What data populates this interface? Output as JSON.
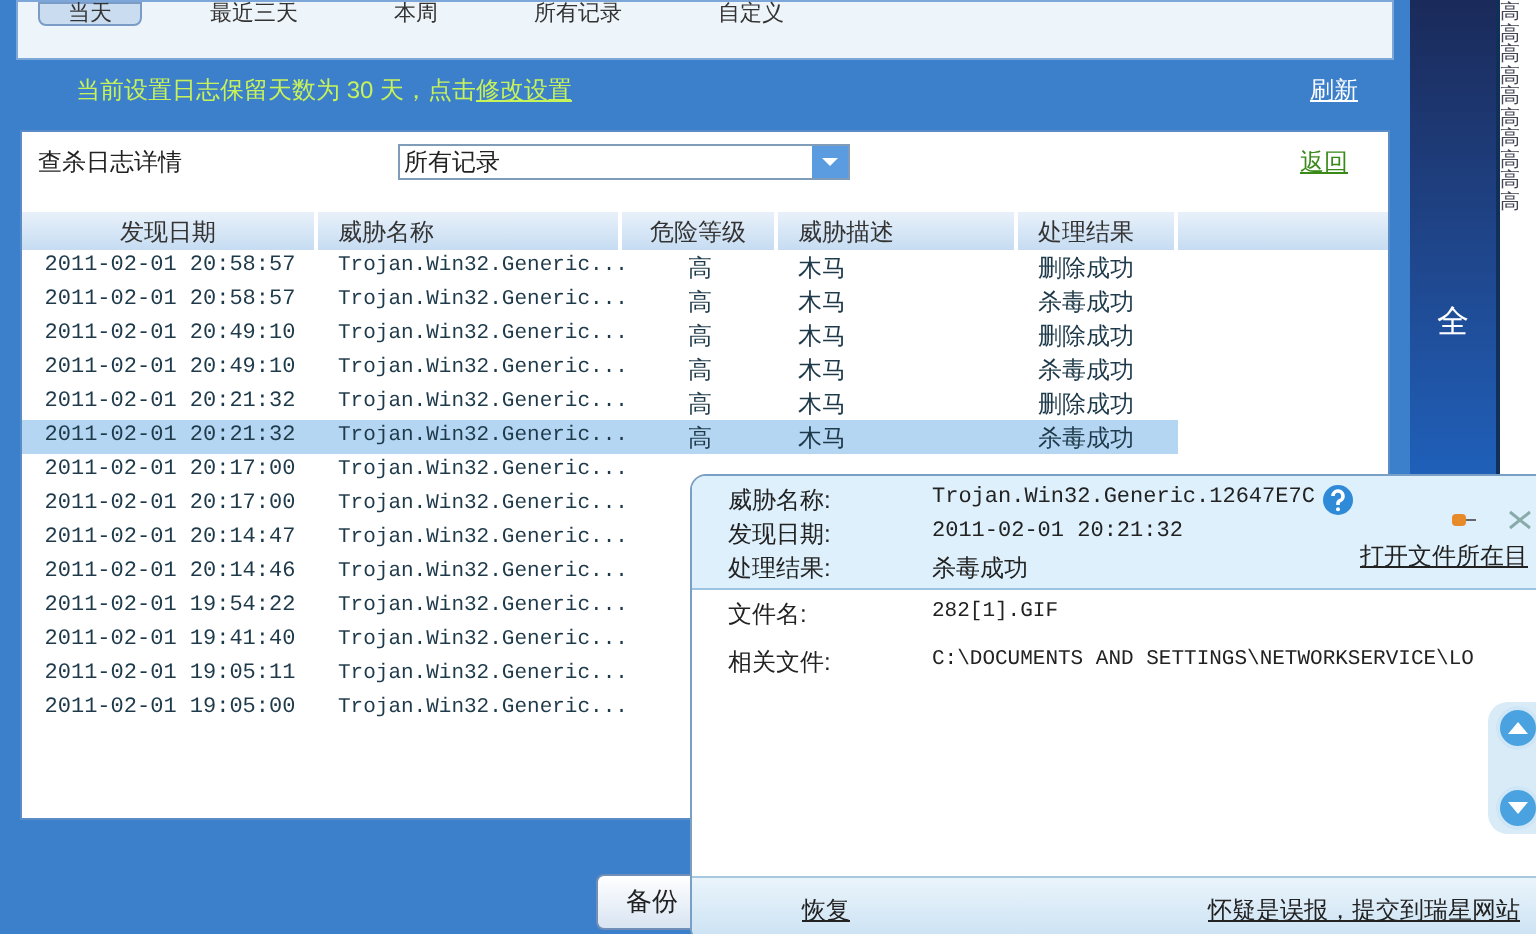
{
  "tabs": [
    {
      "label": "当天",
      "selected": true
    },
    {
      "label": "最近三天",
      "selected": false
    },
    {
      "label": "本周",
      "selected": false
    },
    {
      "label": "所有记录",
      "selected": false
    },
    {
      "label": "自定义",
      "selected": false
    }
  ],
  "notice": {
    "text": "当前设置日志保留天数为 30 天，点击",
    "link": "修改设置"
  },
  "refresh": "刷新",
  "filter": {
    "label": "查杀日志详情",
    "value": "所有记录"
  },
  "back": "返回",
  "table": {
    "columns": [
      "发现日期",
      "威胁名称",
      "危险等级",
      "威胁描述",
      "处理结果"
    ],
    "rows": [
      {
        "date": "2011-02-01 20:58:57",
        "name": "Trojan.Win32.Generic...",
        "level": "高",
        "desc": "木马",
        "result": "删除成功",
        "selected": false
      },
      {
        "date": "2011-02-01 20:58:57",
        "name": "Trojan.Win32.Generic...",
        "level": "高",
        "desc": "木马",
        "result": "杀毒成功",
        "selected": false
      },
      {
        "date": "2011-02-01 20:49:10",
        "name": "Trojan.Win32.Generic...",
        "level": "高",
        "desc": "木马",
        "result": "删除成功",
        "selected": false
      },
      {
        "date": "2011-02-01 20:49:10",
        "name": "Trojan.Win32.Generic...",
        "level": "高",
        "desc": "木马",
        "result": "杀毒成功",
        "selected": false
      },
      {
        "date": "2011-02-01 20:21:32",
        "name": "Trojan.Win32.Generic...",
        "level": "高",
        "desc": "木马",
        "result": "删除成功",
        "selected": false
      },
      {
        "date": "2011-02-01 20:21:32",
        "name": "Trojan.Win32.Generic...",
        "level": "高",
        "desc": "木马",
        "result": "杀毒成功",
        "selected": true
      },
      {
        "date": "2011-02-01 20:17:00",
        "name": "Trojan.Win32.Generic...",
        "selected": false
      },
      {
        "date": "2011-02-01 20:17:00",
        "name": "Trojan.Win32.Generic...",
        "selected": false
      },
      {
        "date": "2011-02-01 20:14:47",
        "name": "Trojan.Win32.Generic...",
        "selected": false
      },
      {
        "date": "2011-02-01 20:14:46",
        "name": "Trojan.Win32.Generic...",
        "selected": false
      },
      {
        "date": "2011-02-01 19:54:22",
        "name": "Trojan.Win32.Generic...",
        "selected": false
      },
      {
        "date": "2011-02-01 19:41:40",
        "name": "Trojan.Win32.Generic...",
        "selected": false
      },
      {
        "date": "2011-02-01 19:05:11",
        "name": "Trojan.Win32.Generic...",
        "selected": false
      },
      {
        "date": "2011-02-01 19:05:00",
        "name": "Trojan.Win32.Generic...",
        "selected": false
      }
    ]
  },
  "backup_button": "备份",
  "desktop": {
    "text": "全",
    "window_cells": [
      "高",
      "高",
      "高",
      "高",
      "高",
      "高",
      "高",
      "高",
      "高",
      "高"
    ]
  },
  "popup": {
    "header": [
      {
        "label": "威胁名称:",
        "value": "Trojan.Win32.Generic.12647E7C"
      },
      {
        "label": "发现日期:",
        "value": "2011-02-01 20:21:32"
      },
      {
        "label": "处理结果:",
        "value": "杀毒成功"
      }
    ],
    "open_folder": "打开文件所在目",
    "details": [
      {
        "label": "文件名:",
        "value": "282[1].GIF"
      },
      {
        "label": "相关文件:",
        "value": "C:\\DOCUMENTS AND SETTINGS\\NETWORKSERVICE\\LO"
      }
    ],
    "restore": "恢复",
    "report": "怀疑是误报，提交到瑞星网站"
  }
}
